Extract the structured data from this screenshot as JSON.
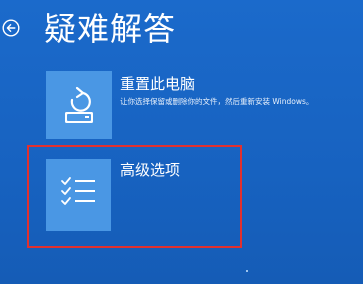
{
  "header": {
    "title": "疑难解答",
    "back_icon": "back-arrow-circle-icon"
  },
  "options": [
    {
      "title": "重置此电脑",
      "description": "让你选择保留或删除你的文件，然后重新安装 Windows。",
      "icon": "reset-pc-icon"
    },
    {
      "title": "高级选项",
      "description": "",
      "icon": "checklist-icon"
    }
  ],
  "colors": {
    "background": "#1a67c4",
    "tile": "#4a97e4",
    "highlight": "#e2302e",
    "text": "#ffffff"
  }
}
